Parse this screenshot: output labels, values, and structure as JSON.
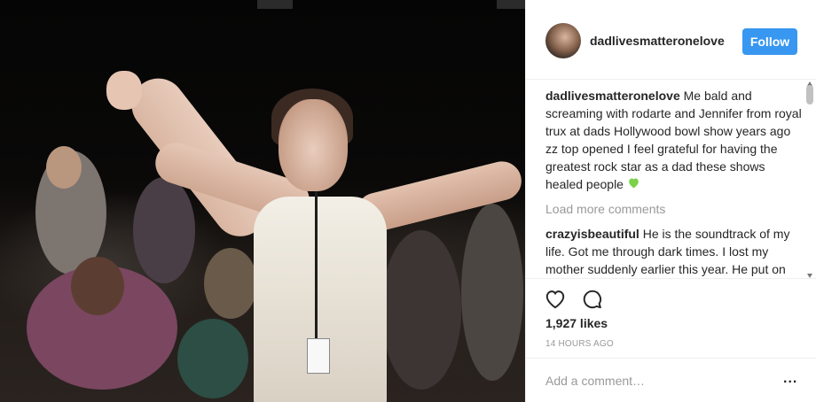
{
  "post": {
    "username": "dadlivesmatteronelove",
    "follow_label": "Follow"
  },
  "comments": [
    {
      "user": "dadlivesmatteronelove",
      "text": "Me bald and screaming with rodarte and Jennifer from royal trux at dads Hollywood bowl show years ago zz top opened I feel grateful for having the greatest rock star as a dad these shows healed people",
      "emoji": "green-heart"
    },
    {
      "user": "crazyisbeautiful",
      "text": "He is the soundtrack of my life. Got me through dark times. I lost my mother suddenly earlier this year. He put on amazing shows, I went with my"
    }
  ],
  "load_more_label": "Load more comments",
  "actions": {
    "likes": "1,927 likes",
    "time": "14 HOURS AGO"
  },
  "add_comment": {
    "placeholder": "Add a comment…",
    "more_label": "..."
  },
  "colors": {
    "follow_bg": "#3897f0",
    "heart": "#7bd148"
  }
}
